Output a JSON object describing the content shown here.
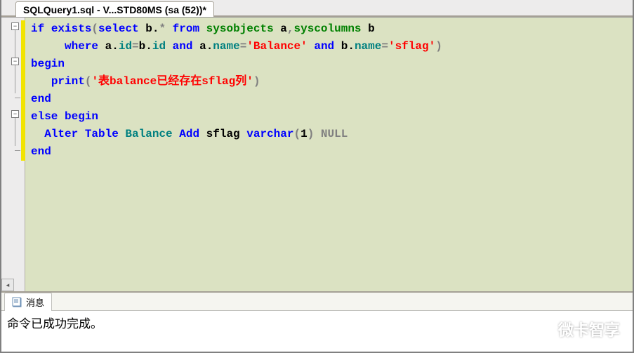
{
  "tab": {
    "title": "SQLQuery1.sql - V...STD80MS (sa (52))*"
  },
  "code": {
    "l1": {
      "kw1": "if",
      "kw2": "exists",
      "p1": "(",
      "kw3": "select",
      "t1": " b",
      "d1": ".",
      "s1": "*",
      "kw4": " from",
      "sys1": " sysobjects",
      "t2": " a",
      "c1": ",",
      "sys2": "syscolumns",
      "t3": " b"
    },
    "l2": {
      "indent": "     ",
      "kw1": "where",
      "t1": " a",
      "d1": ".",
      "n1": "id",
      "eq1": "=",
      "t2": "b",
      "d2": ".",
      "n2": "id",
      "kw2": " and",
      "t3": " a",
      "d3": ".",
      "n3": "name",
      "eq2": "=",
      "s1": "'Balance'",
      "kw3": " and",
      "t4": " b",
      "d4": ".",
      "n4": "name",
      "eq3": "=",
      "s2": "'sflag'",
      "p1": ")"
    },
    "l3": {
      "kw1": "begin"
    },
    "l4": {
      "indent": "   ",
      "kw1": "print",
      "p1": "(",
      "s1": "'表balance已经存在sflag列'",
      "p2": ")"
    },
    "l5": {
      "kw1": "end"
    },
    "l6": {
      "kw1": "else",
      "kw2": " begin"
    },
    "l7": {
      "indent": "  ",
      "kw1": "Alter",
      "kw2": " Table",
      "n1": " Balance",
      "kw3": " Add",
      "t1": " sflag ",
      "kw4": "varchar",
      "p1": "(",
      "num": "1",
      "p2": ")",
      "nl": " NULL"
    },
    "l8": {
      "kw1": "end"
    }
  },
  "messages": {
    "tab_label": "消息",
    "body": "命令已成功完成。"
  },
  "watermark": {
    "text": "微卡智享"
  }
}
